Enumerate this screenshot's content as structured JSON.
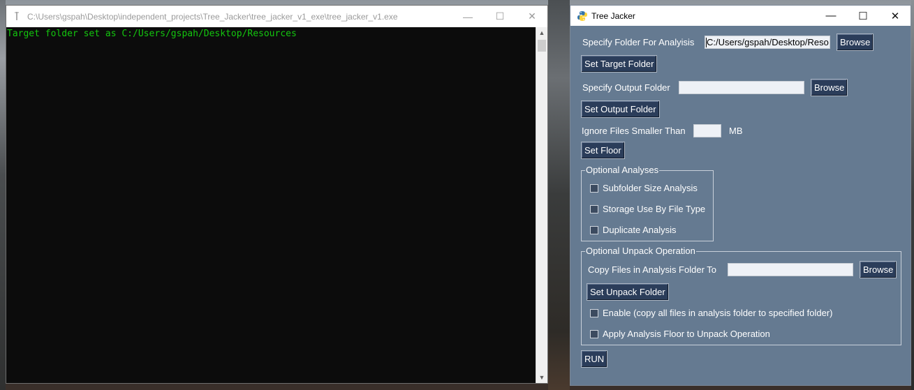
{
  "console": {
    "title": "C:\\Users\\gspah\\Desktop\\independent_projects\\Tree_Jacker\\tree_jacker_v1_exe\\tree_jacker_v1.exe",
    "output_line": "Target folder set as C:/Users/gspah/Desktop/Resources",
    "icon": "console-app-icon"
  },
  "window_controls": {
    "minimize": "—",
    "maximize": "☐",
    "close": "✕"
  },
  "tree_jacker": {
    "title": "Tree Jacker",
    "icon": "python-icon",
    "analysis": {
      "label": "Specify Folder For Analyisis",
      "value": "C:/Users/gspah/Desktop/Reso",
      "browse": "Browse",
      "set_button": "Set Target Folder"
    },
    "output": {
      "label": "Specify Output Folder",
      "value": "",
      "browse": "Browse",
      "set_button": "Set Output Folder"
    },
    "floor": {
      "label": "Ignore Files Smaller Than",
      "value": "",
      "unit": "MB",
      "set_button": "Set Floor"
    },
    "optional_analyses": {
      "title": "Optional Analyses",
      "options": [
        {
          "label": "Subfolder Size Analysis",
          "checked": false
        },
        {
          "label": "Storage Use By File Type",
          "checked": false
        },
        {
          "label": "Duplicate Analysis",
          "checked": false
        }
      ]
    },
    "unpack": {
      "title": "Optional Unpack Operation",
      "label": "Copy Files in Analysis Folder To",
      "value": "",
      "browse": "Browse",
      "set_button": "Set Unpack Folder",
      "options": [
        {
          "label": "Enable (copy all files in analysis folder to specified folder)",
          "checked": false
        },
        {
          "label": "Apply Analysis Floor to Unpack Operation",
          "checked": false
        }
      ]
    },
    "run": "RUN"
  },
  "colors": {
    "window_bg": "#657a91",
    "button_bg": "#2b3d5a",
    "console_text": "#13c60e",
    "console_bg": "#0c0c0c"
  }
}
